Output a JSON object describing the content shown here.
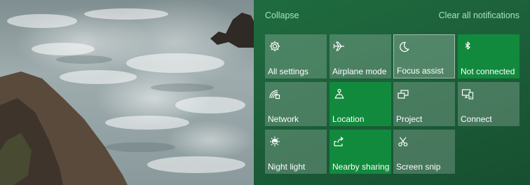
{
  "header": {
    "collapse_label": "Collapse",
    "clear_label": "Clear all notifications"
  },
  "colors": {
    "panel_bg": "#1c5f39",
    "tile_on": "#118a3d",
    "link": "#a9e2c1"
  },
  "tiles": [
    {
      "label": "All settings",
      "icon": "gear-icon",
      "state": "off"
    },
    {
      "label": "Airplane mode",
      "icon": "airplane-icon",
      "state": "off"
    },
    {
      "label": "Focus assist",
      "icon": "moon-icon",
      "state": "focused"
    },
    {
      "label": "Not connected",
      "icon": "bluetooth-icon",
      "state": "on"
    },
    {
      "label": "Network",
      "icon": "network-icon",
      "state": "off"
    },
    {
      "label": "Location",
      "icon": "location-icon",
      "state": "on"
    },
    {
      "label": "Project",
      "icon": "project-icon",
      "state": "off"
    },
    {
      "label": "Connect",
      "icon": "connect-icon",
      "state": "off"
    },
    {
      "label": "Night light",
      "icon": "sun-icon",
      "state": "off"
    },
    {
      "label": "Nearby sharing",
      "icon": "share-icon",
      "state": "on"
    },
    {
      "label": "Screen snip",
      "icon": "screen-snip-icon",
      "state": "off"
    }
  ]
}
